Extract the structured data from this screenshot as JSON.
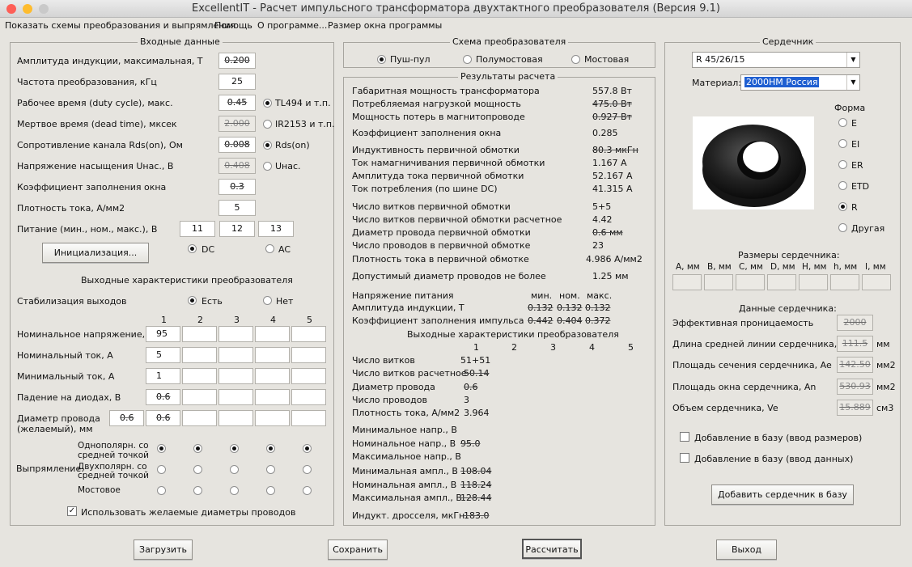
{
  "window": {
    "title": "ExcellentIT - Расчет импульсного трансформатора двухтактного преобразователя (Версия 9.1)"
  },
  "menu": [
    "Показать схемы преобразования и выпрямления",
    "Помощь",
    "О программе...",
    "Размер окна программы"
  ],
  "input": {
    "title": "Входные данные",
    "rows": [
      {
        "label": "Амплитуда индукции, максимальная, Т",
        "value": "0.200"
      },
      {
        "label": "Частота преобразования, кГц",
        "value": "25"
      },
      {
        "label": "Рабочее время (duty cycle), макс.",
        "value": "0.45"
      },
      {
        "label": "Мертвое время (dead time), мксек",
        "value": "2.000"
      },
      {
        "label": "Сопротивление канала Rds(on), Ом",
        "value": "0.008"
      },
      {
        "label": "Напряжение насыщения Uнас., В",
        "value": "0.408"
      },
      {
        "label": "Коэффициент заполнения окна",
        "value": "0.3"
      },
      {
        "label": "Плотность тока, А/мм2",
        "value": "5"
      }
    ],
    "supply_label": "Питание (мин., ном., макс.), В",
    "supply": [
      "11",
      "12",
      "13"
    ],
    "controller_options": [
      "TL494 и т.п.",
      "IR2153 и т.п."
    ],
    "switch_options": [
      "Rds(on)",
      "Uнас."
    ],
    "init_button": "Инициализация...",
    "dc": "DC",
    "ac": "AC"
  },
  "output": {
    "title": "Выходные характеристики преобразователя",
    "stab_label": "Стабилизация выходов",
    "stab_yes": "Есть",
    "stab_no": "Нет",
    "cols": [
      "1",
      "2",
      "3",
      "4",
      "5"
    ],
    "rows": [
      {
        "label": "Номинальное напряжение, В",
        "values": [
          "95",
          "",
          "",
          "",
          ""
        ]
      },
      {
        "label": "Номинальный ток, А",
        "values": [
          "5",
          "",
          "",
          "",
          ""
        ]
      },
      {
        "label": "Минимальный ток, А",
        "values": [
          "1",
          "",
          "",
          "",
          ""
        ]
      },
      {
        "label": "Падение на диодах, В",
        "values": [
          "0.6",
          "",
          "",
          "",
          ""
        ]
      }
    ],
    "wire_label1": "Диаметр провода",
    "wire_label2": "(желаемый), мм",
    "wire_values": [
      "0.6",
      "0.6",
      "",
      "",
      "",
      ""
    ],
    "rect_label": "Выпрямление:",
    "rect_opt1a": "Однополярн. со",
    "rect_opt1b": "средней точкой",
    "rect_opt2a": "Двухполярн. со",
    "rect_opt2b": "средней точкой",
    "rect_opt3": "Мостовое",
    "use_wire_label": "Использовать желаемые диаметры проводов"
  },
  "scheme": {
    "title": "Схема преобразователя",
    "options": [
      "Пуш-пул",
      "Полумостовая",
      "Мостовая"
    ]
  },
  "results": {
    "title": "Результаты расчета",
    "rows": [
      {
        "label": "Габаритная мощность трансформатора",
        "value": "557.8 Вт"
      },
      {
        "label": "Потребляемая нагрузкой мощность",
        "value": "475.0 Вт"
      },
      {
        "label": "Мощность потерь в магнитопроводе",
        "value": "0.927 Вт"
      },
      {
        "label": "Коэффициент заполнения окна",
        "value": "0.285"
      },
      {
        "label": "Индуктивность первичной обмотки",
        "value": "80.3 мкГн"
      },
      {
        "label": "Ток намагничивания первичной обмотки",
        "value": "1.167 А"
      },
      {
        "label": "Амплитуда тока первичной обмотки",
        "value": "52.167 А"
      },
      {
        "label": "Ток потребления (по шине DC)",
        "value": "41.315 А"
      },
      {
        "label": "Число витков первичной обмотки",
        "value": "5+5"
      },
      {
        "label": "Число витков первичной обмотки расчетное",
        "value": "4.42"
      },
      {
        "label": "Диаметр провода первичной обмотки",
        "value": "0.6 мм"
      },
      {
        "label": "Число проводов в первичной обмотке",
        "value": "23"
      },
      {
        "label": "Плотность тока в первичной обмотке",
        "value": "4.986 А/мм2"
      },
      {
        "label": "Допустимый диаметр проводов не более",
        "value": "1.25 мм"
      }
    ],
    "vhead": [
      "мин.",
      "ном.",
      "макс."
    ],
    "vrows": [
      {
        "label": "Напряжение питания",
        "values": [
          "",
          "",
          ""
        ]
      },
      {
        "label": "Амплитуда индукции, Т",
        "values": [
          "0.132",
          "0.132",
          "0.132"
        ]
      },
      {
        "label": "Коэффициент заполнения импульса",
        "values": [
          "0.442",
          "0.404",
          "0.372"
        ]
      }
    ],
    "out_title": "Выходные характеристики преобразователя",
    "out_cols": [
      "1",
      "2",
      "3",
      "4",
      "5"
    ],
    "orows": [
      {
        "label": "Число витков",
        "value": "51+51"
      },
      {
        "label": "Число витков расчетное",
        "value": "50.14"
      },
      {
        "label": "Диаметр провода",
        "value": "0.6"
      },
      {
        "label": "Число проводов",
        "value": "3"
      },
      {
        "label": "Плотность тока, А/мм2",
        "value": "3.964"
      },
      {
        "label": "Минимальное напр., В",
        "value": ""
      },
      {
        "label": "Номинальное напр., В",
        "value": "95.0"
      },
      {
        "label": "Максимальное напр., В",
        "value": ""
      },
      {
        "label": "Минимальная ампл., В",
        "value": "108.04"
      },
      {
        "label": "Номинальная ампл., В",
        "value": "118.24"
      },
      {
        "label": "Максимальная ампл., В",
        "value": "128.44"
      },
      {
        "label": "Индукт. дросселя, мкГн",
        "value": "183.0"
      }
    ]
  },
  "core": {
    "title": "Сердечник",
    "selected": "R 45/26/15",
    "material_label": "Материал:",
    "material": "2000НМ Россия",
    "shape_label": "Форма",
    "shapes": [
      "E",
      "EI",
      "ER",
      "ETD",
      "R",
      "Другая"
    ],
    "dims_title": "Размеры сердечника:",
    "dims": [
      "A, мм",
      "B, мм",
      "C, мм",
      "D, мм",
      "H, мм",
      "h, мм",
      "I, мм"
    ],
    "data_title": "Данные сердечника:",
    "data": [
      {
        "label": "Эффективная проницаемость",
        "value": "2000",
        "unit": ""
      },
      {
        "label": "Длина средней линии сердечника, le",
        "value": "111.5",
        "unit": "мм"
      },
      {
        "label": "Площадь сечения сердечника, Ae",
        "value": "142.50",
        "unit": "мм2"
      },
      {
        "label": "Площадь окна сердечника, An",
        "value": "530.93",
        "unit": "мм2"
      },
      {
        "label": "Объем сердечника, Ve",
        "value": "15.889",
        "unit": "см3"
      }
    ],
    "add_dims": "Добавление в базу (ввод размеров)",
    "add_data": "Добавление в базу (ввод данных)",
    "add_button": "Добавить сердечник в базу"
  },
  "buttons": {
    "load": "Загрузить",
    "save": "Сохранить",
    "calc": "Рассчитать",
    "exit": "Выход"
  },
  "colors": {
    "close": "#fe5f57",
    "minimize": "#febc2e",
    "maximize": "#c9c9c9",
    "window_bg": "#e6e4df",
    "selection": "#1f5fd1"
  }
}
